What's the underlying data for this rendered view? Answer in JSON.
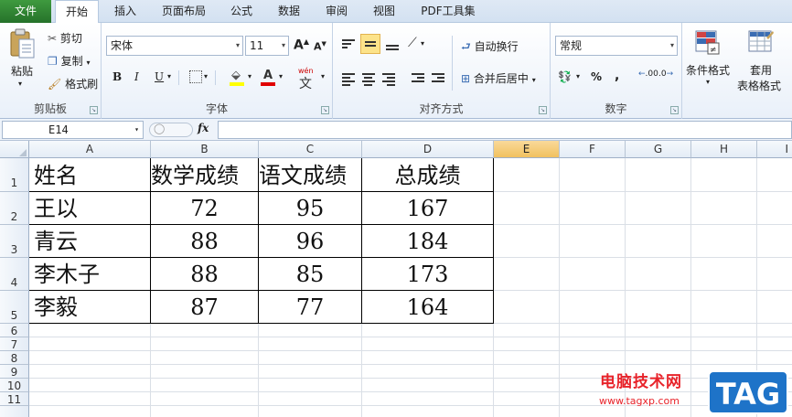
{
  "tabs": [
    "文件",
    "开始",
    "插入",
    "页面布局",
    "公式",
    "数据",
    "审阅",
    "视图",
    "PDF工具集"
  ],
  "clipboard": {
    "paste": "粘贴",
    "cut": "剪切",
    "copy": "复制",
    "format_painter": "格式刷",
    "label": "剪贴板"
  },
  "font": {
    "name": "宋体",
    "size": "11",
    "bold": "B",
    "italic": "I",
    "underline": "U",
    "grow": "A",
    "shrink": "A",
    "label": "字体",
    "wen": "wén",
    "wen_char": "文"
  },
  "alignment": {
    "wrap": "自动换行",
    "merge": "合并后居中",
    "label": "对齐方式"
  },
  "number": {
    "format": "常规",
    "percent": "%",
    "comma": ",",
    "inc_decimal": ".00",
    "dec_decimal": ".0",
    "label": "数字"
  },
  "styles": {
    "conditional": "条件格式",
    "table_format_line1": "套用",
    "table_format_line2": "表格格式"
  },
  "formula_bar": {
    "name_box": "E14",
    "fx": "fx",
    "value": ""
  },
  "columns": [
    "A",
    "B",
    "C",
    "D",
    "E",
    "F",
    "G",
    "H",
    "I"
  ],
  "rows": [
    "1",
    "2",
    "3",
    "4",
    "5",
    "6",
    "7",
    "8",
    "9",
    "10",
    "11"
  ],
  "table": {
    "headers": [
      "姓名",
      "数学成绩",
      "语文成绩",
      "总成绩"
    ],
    "records": [
      [
        "王以",
        "72",
        "95",
        "167"
      ],
      [
        "青云",
        "88",
        "96",
        "184"
      ],
      [
        "李木子",
        "88",
        "85",
        "173"
      ],
      [
        "李毅",
        "87",
        "77",
        "164"
      ]
    ]
  },
  "watermark": {
    "site": "电脑技术网",
    "url": "www.tagxp.com",
    "logo": "TAG"
  },
  "colors": {
    "file_tab": "#2f7a2f",
    "selected_header": "#f1c15f",
    "accent_red": "#e8232a",
    "logo_blue": "#1e73c8"
  }
}
